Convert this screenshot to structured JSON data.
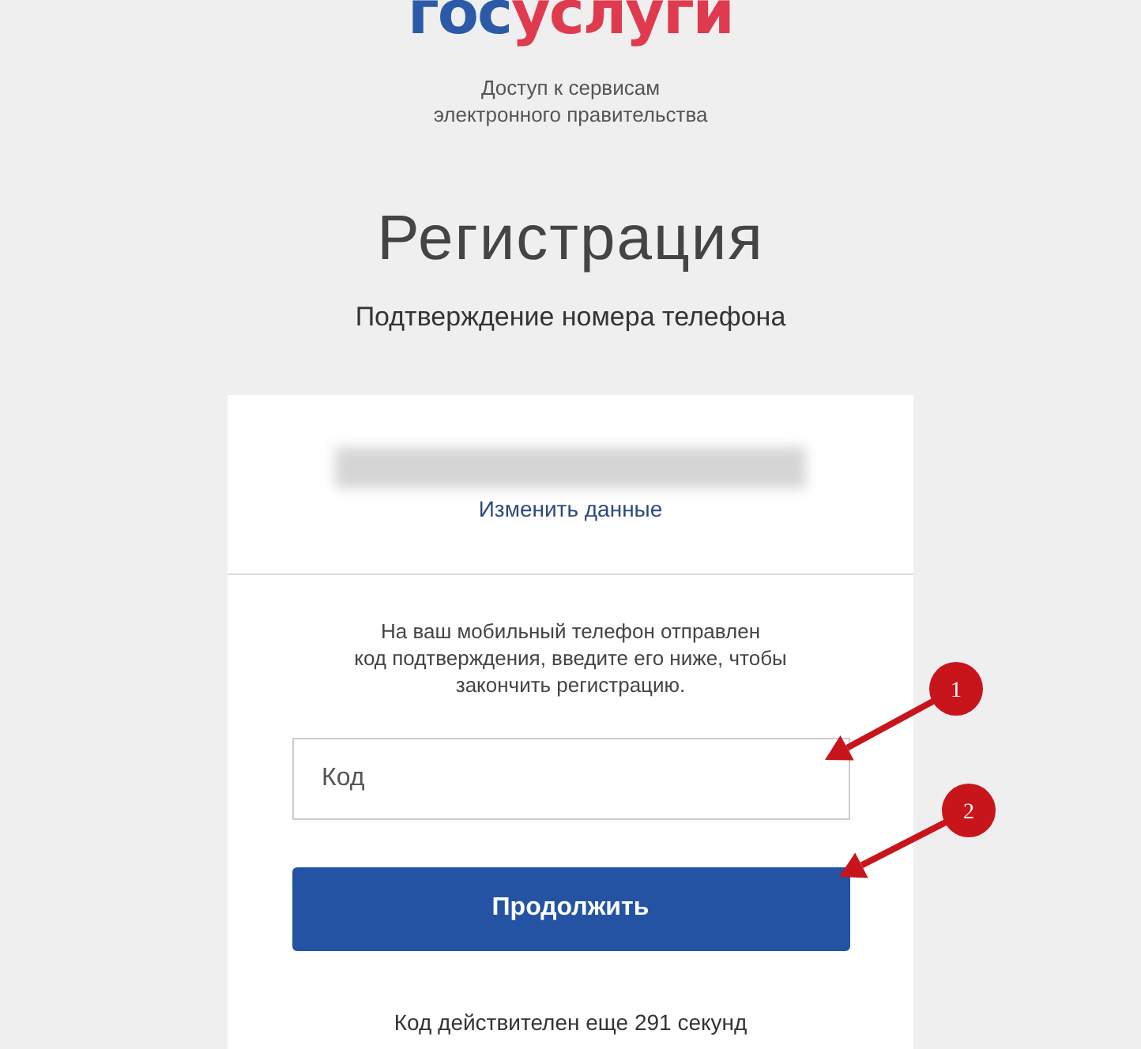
{
  "logo": {
    "parts": [
      "гос",
      "услуги"
    ]
  },
  "tagline": [
    "Доступ к сервисам",
    "электронного правительства"
  ],
  "title": "Регистрация",
  "subtitle": "Подтверждение номера телефона",
  "card": {
    "change_link": "Изменить данные",
    "message": [
      "На ваш мобильный телефон отправлен",
      "код подтверждения, введите его ниже, чтобы",
      "закончить регистрацию."
    ],
    "code_field": {
      "placeholder": "Код"
    },
    "submit_button": "Продолжить",
    "timer": "Код действителен еще 291 секунд"
  },
  "annotations": [
    {
      "number": "1"
    },
    {
      "number": "2"
    }
  ]
}
